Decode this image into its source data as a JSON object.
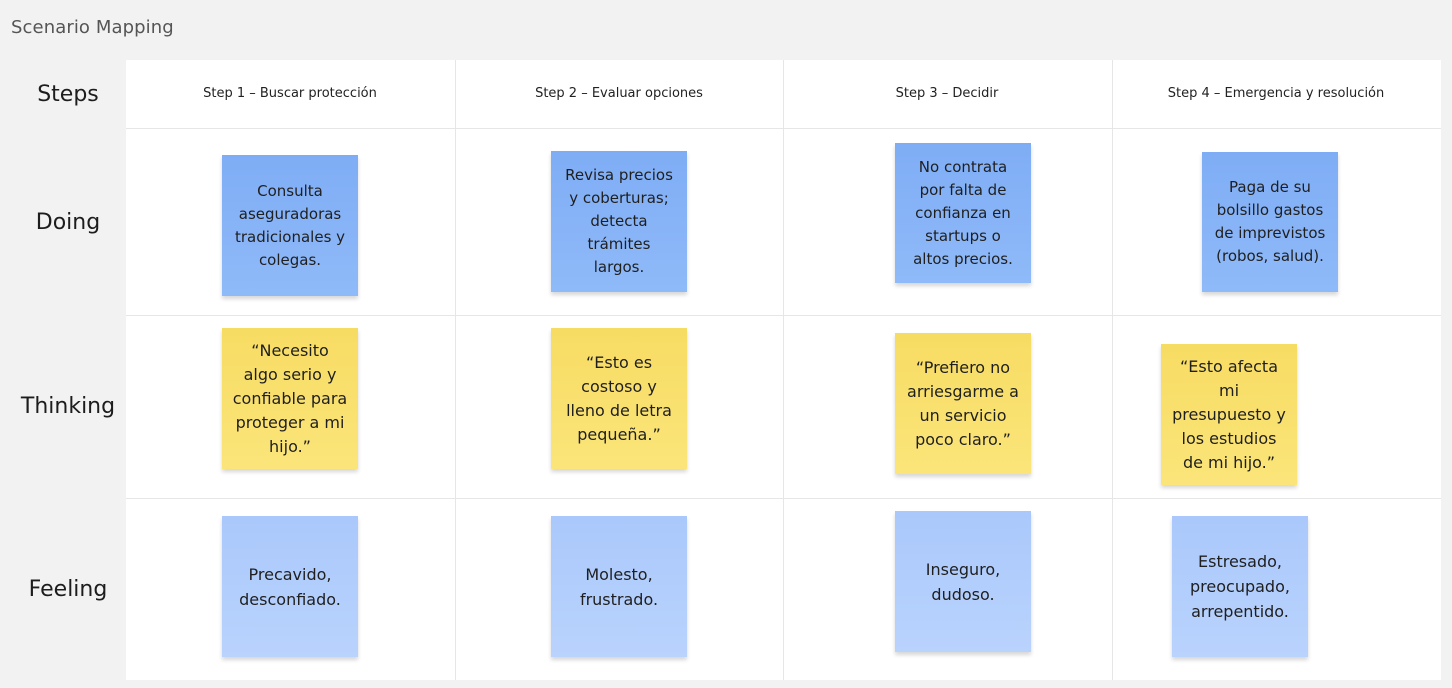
{
  "frame_title": "Scenario Mapping",
  "rows": [
    "Steps",
    "Doing",
    "Thinking",
    "Feeling"
  ],
  "steps": [
    {
      "label": "Step 1 – Buscar protección"
    },
    {
      "label": "Step 2 – Evaluar opciones"
    },
    {
      "label": "Step 3 – Decidir"
    },
    {
      "label": "Step 4 – Emergencia y resolución"
    }
  ],
  "notes": {
    "doing": [
      "Consulta aseguradoras tradicionales y colegas.",
      "Revisa precios y coberturas; detecta trámites largos.",
      "No contrata por falta de confianza en startups o altos precios.",
      "Paga de su bolsillo gastos de imprevistos (robos, salud)."
    ],
    "thinking": [
      "“Necesito algo serio y confiable para proteger a mi hijo.”",
      "“Esto es costoso y lleno de letra pequeña.”",
      "“Prefiero no arriesgarme a un servicio poco claro.”",
      "“Esto afecta mi presupuesto y los estudios de mi hijo.”"
    ],
    "feeling": [
      "Precavido, desconfiado.",
      "Molesto, frustrado.",
      "Inseguro, dudoso.",
      "Estresado, preocupado, arrepentido."
    ]
  },
  "colors": {
    "doing_note": "#8fb6f8",
    "thinking_note": "#f9e06f",
    "feeling_note": "#b3cffc",
    "canvas": "#f2f2f2"
  }
}
